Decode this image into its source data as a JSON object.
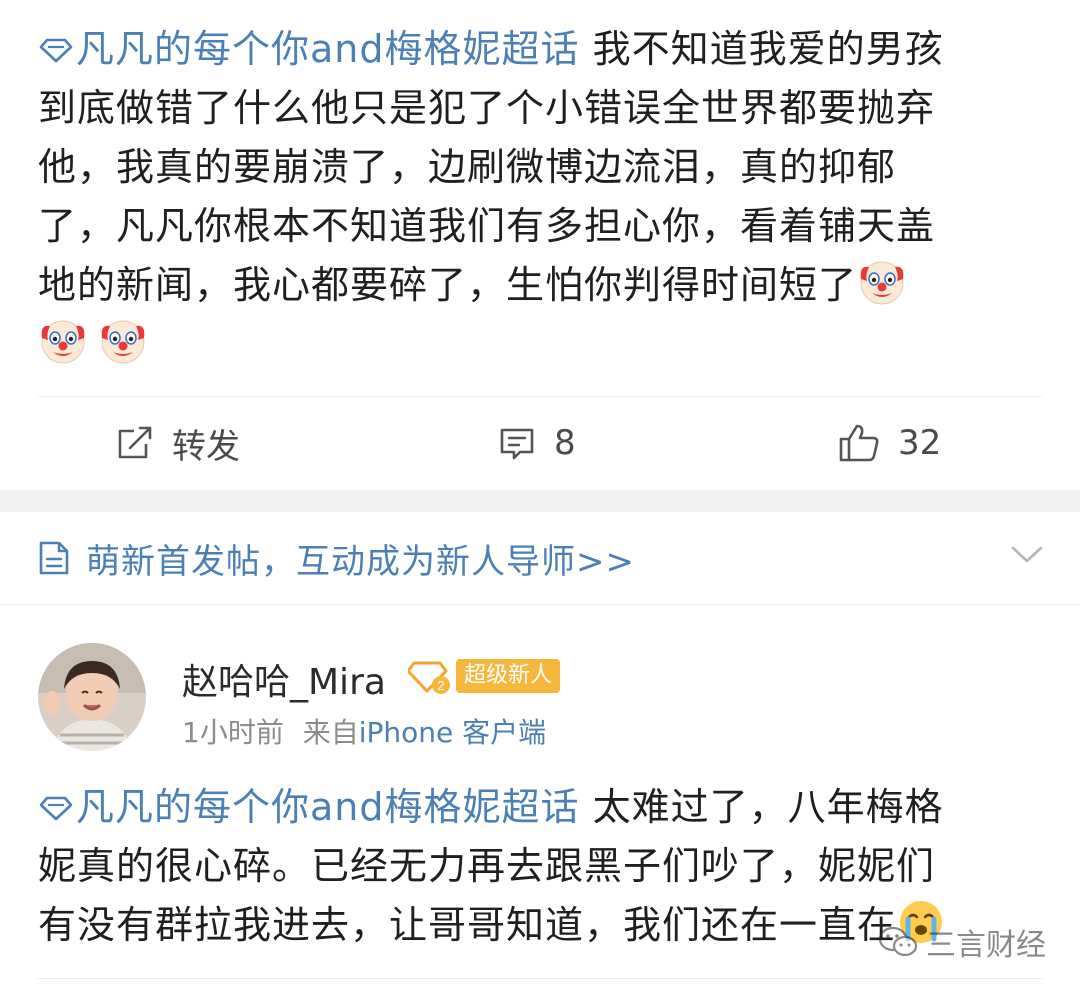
{
  "post1": {
    "topic": "凡凡的每个你and梅格妮超话",
    "line1_rest": "我不知道我爱的男孩",
    "line2": "到底做错了什么他只是犯了个小错误全世界都要抛弃",
    "line3": "他，我真的要崩溃了，边刷微博边流泪，真的抑郁",
    "line4": "了，凡凡你根本不知道我们有多担心你，看着铺天盖",
    "line5": "地的新闻，我心都要碎了，生怕你判得时间短了",
    "emojis": [
      "clown-face",
      "clown-face",
      "clown-face"
    ]
  },
  "actions": {
    "repost_label": "转发",
    "comment_count": "8",
    "like_count": "32"
  },
  "hot_bar": {
    "text": "萌新首发帖，互动成为新人导师>>"
  },
  "user": {
    "name": "赵哈哈_Mira",
    "badge": "超级新人",
    "time": "1小时前",
    "from_prefix": "来自",
    "device": "iPhone 客户端"
  },
  "post2": {
    "topic": "凡凡的每个你and梅格妮超话",
    "line1_rest": "太难过了，八年梅格",
    "line2": "妮真的很心碎。已经无力再去跟黑子们吵了，妮妮们",
    "line3": "有没有群拉我进去，让哥哥知道，我们还在一直在",
    "emoji": "crying-face"
  },
  "watermark": "三言财经",
  "colors": {
    "link": "#4b7fb5",
    "badge": "#f6b73c",
    "text": "#1f1f1f",
    "muted": "#8c8c8c"
  }
}
